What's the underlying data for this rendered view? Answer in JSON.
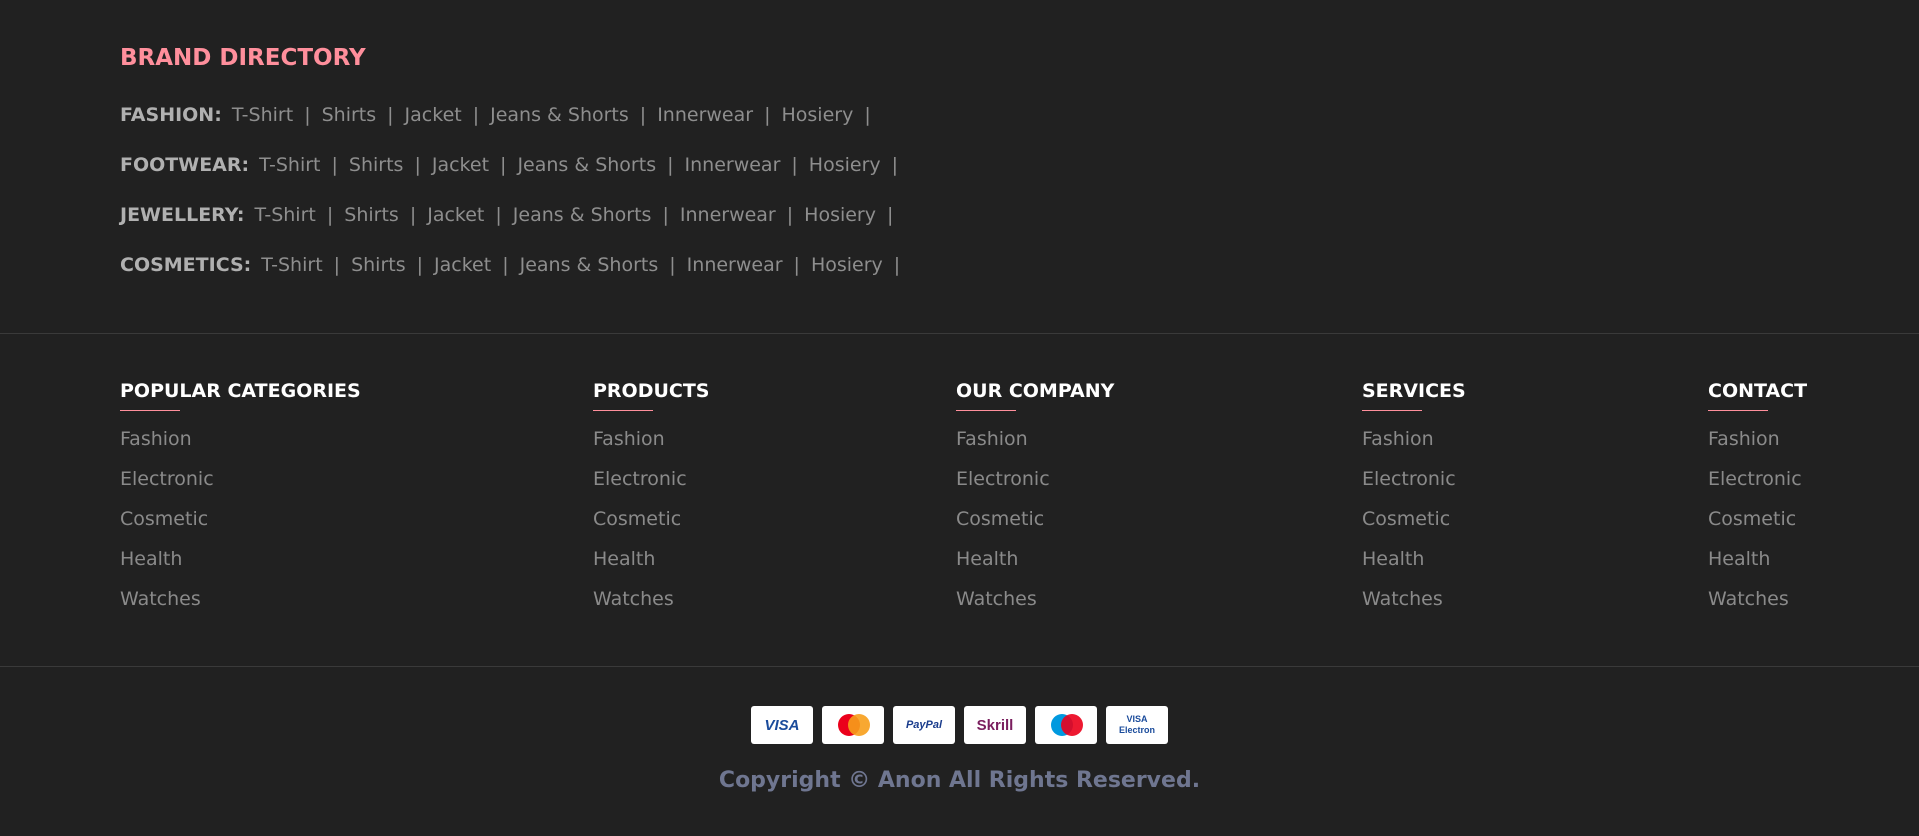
{
  "brand_directory": {
    "title": "BRAND DIRECTORY",
    "rows": [
      {
        "label": "FASHION:",
        "links": [
          "T-Shirt",
          "Shirts",
          "Jacket",
          "Jeans & Shorts",
          "Innerwear",
          "Hosiery"
        ]
      },
      {
        "label": "FOOTWEAR:",
        "links": [
          "T-Shirt",
          "Shirts",
          "Jacket",
          "Jeans & Shorts",
          "Innerwear",
          "Hosiery"
        ]
      },
      {
        "label": "JEWELLERY:",
        "links": [
          "T-Shirt",
          "Shirts",
          "Jacket",
          "Jeans & Shorts",
          "Innerwear",
          "Hosiery"
        ]
      },
      {
        "label": "COSMETICS:",
        "links": [
          "T-Shirt",
          "Shirts",
          "Jacket",
          "Jeans & Shorts",
          "Innerwear",
          "Hosiery"
        ]
      }
    ],
    "separator": "|"
  },
  "footer_columns": [
    {
      "title": "POPULAR CATEGORIES",
      "items": [
        "Fashion",
        "Electronic",
        "Cosmetic",
        "Health",
        "Watches"
      ]
    },
    {
      "title": "PRODUCTS",
      "items": [
        "Fashion",
        "Electronic",
        "Cosmetic",
        "Health",
        "Watches"
      ]
    },
    {
      "title": "OUR COMPANY",
      "items": [
        "Fashion",
        "Electronic",
        "Cosmetic",
        "Health",
        "Watches"
      ]
    },
    {
      "title": "SERVICES",
      "items": [
        "Fashion",
        "Electronic",
        "Cosmetic",
        "Health",
        "Watches"
      ]
    },
    {
      "title": "CONTACT",
      "items": [
        "Fashion",
        "Electronic",
        "Cosmetic",
        "Health",
        "Watches"
      ]
    }
  ],
  "payments": {
    "visa": "VISA",
    "mastercard": "MasterCard",
    "paypal": "PayPal",
    "skrill": "Skrill",
    "maestro": "Maestro",
    "visa_electron_top": "VISA",
    "visa_electron_bottom": "Electron"
  },
  "copyright": "Copyright © Anon All Rights Reserved.",
  "colors": {
    "background": "#212121",
    "accent": "#ff8f9c",
    "muted_text": "#8a8a8a",
    "copyright": "#6f7690"
  }
}
